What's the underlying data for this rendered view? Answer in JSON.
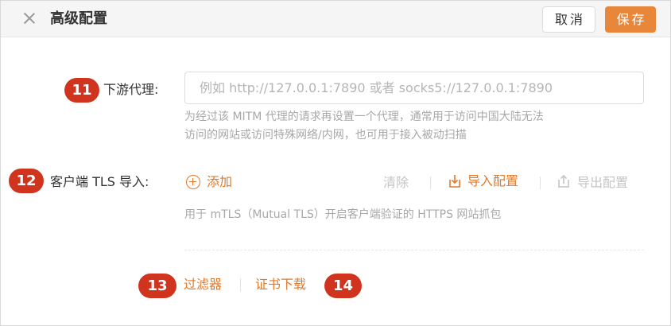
{
  "header": {
    "title": "高级配置",
    "cancel_label": "取消",
    "save_label": "保存"
  },
  "proxy": {
    "badge": "11",
    "label": "下游代理:",
    "placeholder": "例如 http://127.0.0.1:7890 或者 socks5://127.0.0.1:7890",
    "hint_line1": "为经过该 MITM 代理的请求再设置一个代理，通常用于访问中国大陆无法",
    "hint_line2": "访问的网站或访问特殊网络/内网，也可用于接入被动扫描"
  },
  "tls": {
    "badge": "12",
    "label": "客户端 TLS 导入:",
    "add_label": "添加",
    "clear_label": "清除",
    "import_label": "导入配置",
    "export_label": "导出配置",
    "hint": "用于 mTLS（Mutual TLS）开启客户端验证的 HTTPS 网站抓包"
  },
  "footer": {
    "badge_filter": "13",
    "filter_label": "过滤器",
    "cert_label": "证书下载",
    "badge_cert": "14"
  },
  "colors": {
    "accent": "#e8873a",
    "link": "#e07a2c",
    "badge": "#d0341f"
  }
}
